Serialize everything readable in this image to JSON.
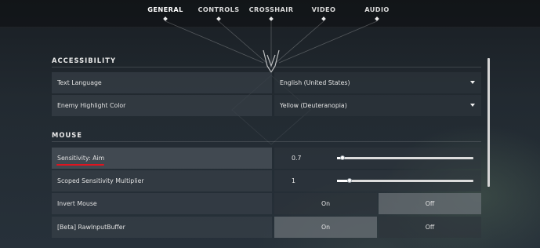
{
  "nav": {
    "tabs": [
      {
        "label": "GENERAL",
        "active": true
      },
      {
        "label": "CONTROLS",
        "active": false
      },
      {
        "label": "CROSSHAIR",
        "active": false
      },
      {
        "label": "VIDEO",
        "active": false
      },
      {
        "label": "AUDIO",
        "active": false
      }
    ]
  },
  "accessibility": {
    "title": "ACCESSIBILITY",
    "text_language": {
      "label": "Text Language",
      "value": "English (United States)"
    },
    "enemy_highlight": {
      "label": "Enemy Highlight Color",
      "value": "Yellow (Deuteranopia)"
    }
  },
  "mouse": {
    "title": "MOUSE",
    "sensitivity_aim": {
      "label": "Sensitivity: Aim",
      "value": "0.7",
      "slider_fraction": 0.04
    },
    "scoped_multiplier": {
      "label": "Scoped Sensitivity Multiplier",
      "value": "1",
      "slider_fraction": 0.09
    },
    "invert_mouse": {
      "label": "Invert Mouse",
      "on_label": "On",
      "off_label": "Off",
      "selected": "Off"
    },
    "raw_input": {
      "label": "[Beta] RawInputBuffer",
      "on_label": "On",
      "off_label": "Off",
      "selected": "On"
    }
  },
  "colors": {
    "annotation_underline": "#e0141f",
    "selected_toggle": "#6a7076"
  },
  "icons": {
    "dropdown": "caret-down-icon"
  }
}
